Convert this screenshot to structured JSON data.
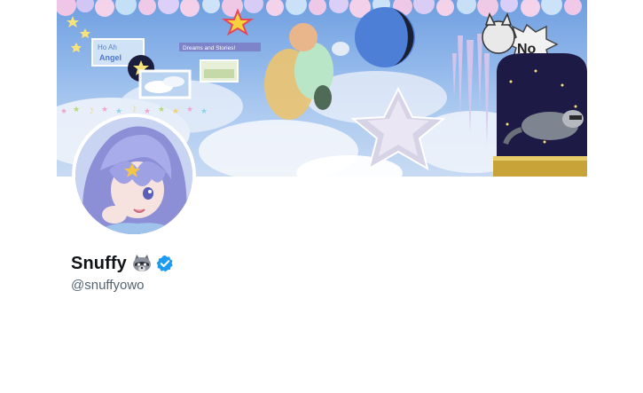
{
  "profile": {
    "display_name": "Snuffy",
    "name_emoji": "raccoon-emoji",
    "verified": true,
    "handle": "@snuffyowo"
  },
  "banner": {
    "sticker_texts": [
      "No",
      "Dreams and Stories!"
    ],
    "alt_text": "Pastel collage banner with clouds, stars, planet, angel, and raccoon"
  },
  "colors": {
    "verified_blue": "#1d9bf0",
    "name_text": "#0f1419",
    "handle_text": "#536471"
  }
}
